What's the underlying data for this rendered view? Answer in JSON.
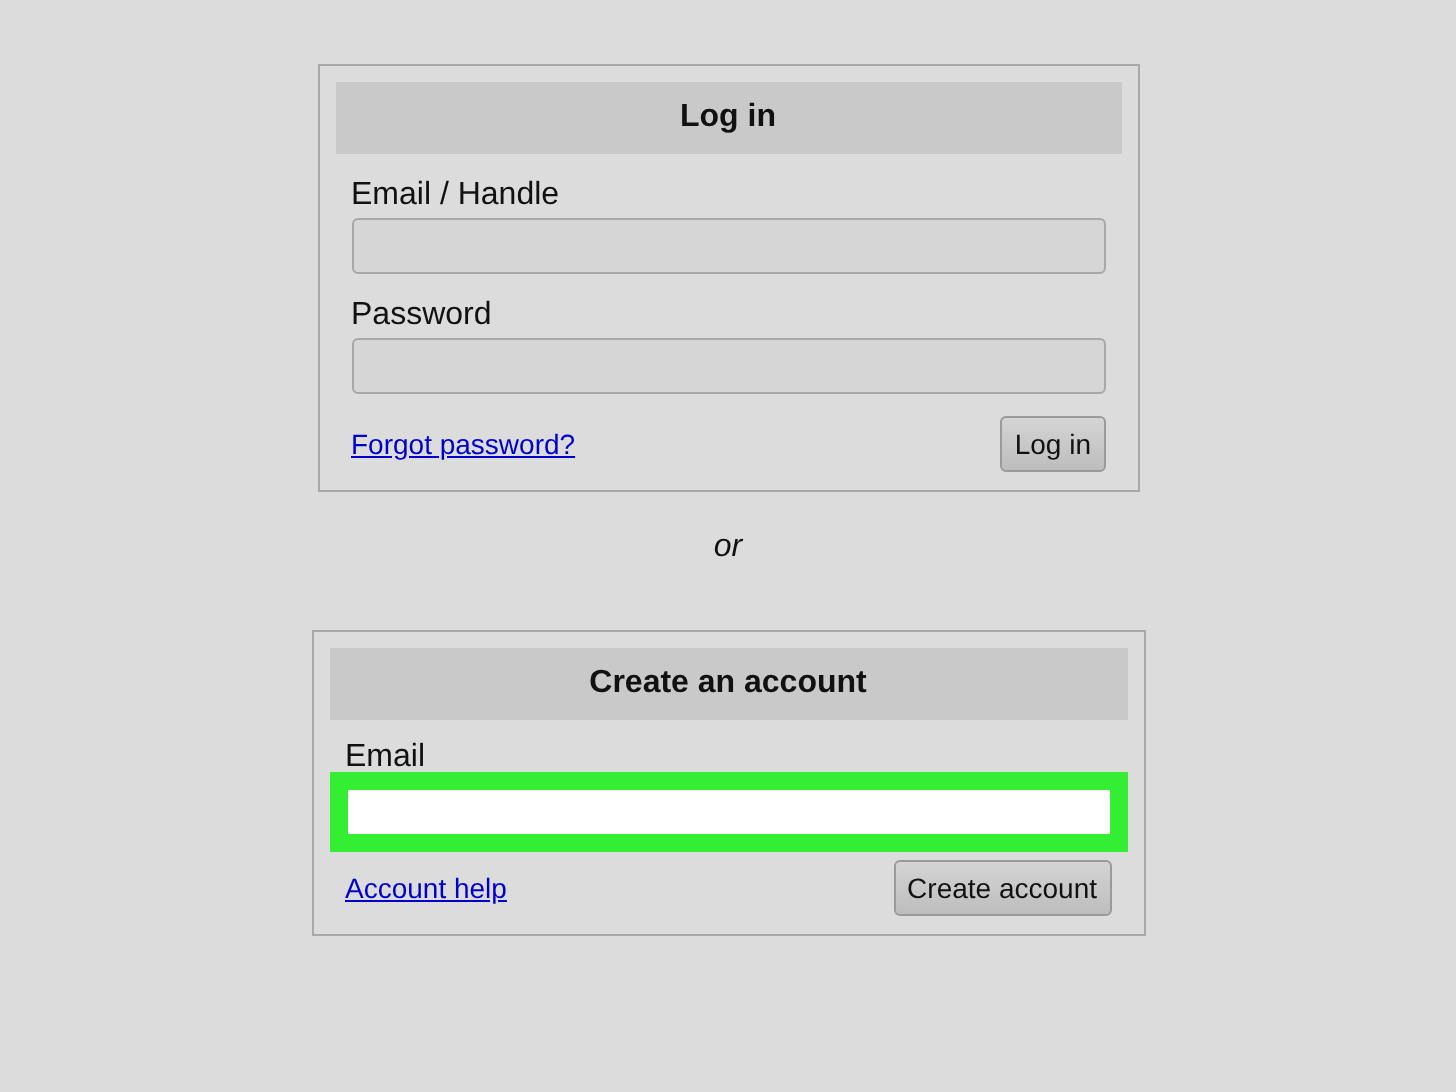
{
  "login": {
    "title": "Log in",
    "fields": [
      {
        "label": "Email / Handle",
        "highlighted": false
      },
      {
        "label": "Password",
        "highlighted": false
      }
    ],
    "link": "Forgot password?",
    "button": "Log in"
  },
  "separator": "or",
  "signup": {
    "title": "Create an account",
    "fields": [
      {
        "label": "Email",
        "highlighted": true
      }
    ],
    "link": "Account help",
    "button": "Create account"
  }
}
